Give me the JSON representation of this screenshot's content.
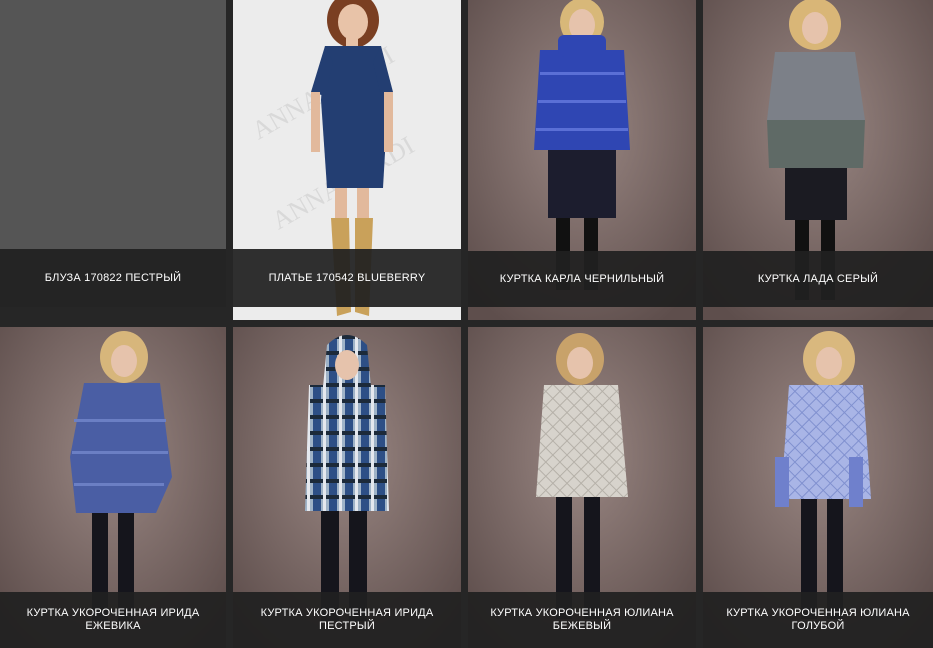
{
  "products": [
    {
      "title": "БЛУЗА 170822 ПЕСТРЫЙ",
      "photo": "none"
    },
    {
      "title": "ПЛАТЬЕ 170542 BLUEBERRY",
      "photo": "model-in-navy-dress"
    },
    {
      "title": "КУРТКА КАРЛА ЧЕРНИЛЬНЫЙ",
      "photo": "model-in-blue-puffer-jacket"
    },
    {
      "title": "КУРТКА ЛАДА СЕРЫЙ",
      "photo": "model-in-grey-jacket"
    },
    {
      "title": "КУРТКА УКОРОЧЕННАЯ ИРИДА ЕЖЕВИКА",
      "photo": "model-in-blue-puffer-coat"
    },
    {
      "title": "КУРТКА УКОРОЧЕННАЯ ИРИДА ПЕСТРЫЙ",
      "photo": "model-in-print-hooded-jacket"
    },
    {
      "title": "КУРТКА УКОРОЧЕННАЯ ЮЛИАНА БЕЖЕВЫЙ",
      "photo": "model-in-beige-quilted-jacket"
    },
    {
      "title": "КУРТКА УКОРОЧЕННАЯ ЮЛИАНА ГОЛУБОЙ",
      "photo": "model-in-light-blue-quilted-jacket"
    }
  ],
  "watermark": "ANNA VERDI",
  "colors": {
    "backdrop_brown": "#7d6a66",
    "caption_bg": "#202020",
    "empty_tile": "#555555"
  }
}
